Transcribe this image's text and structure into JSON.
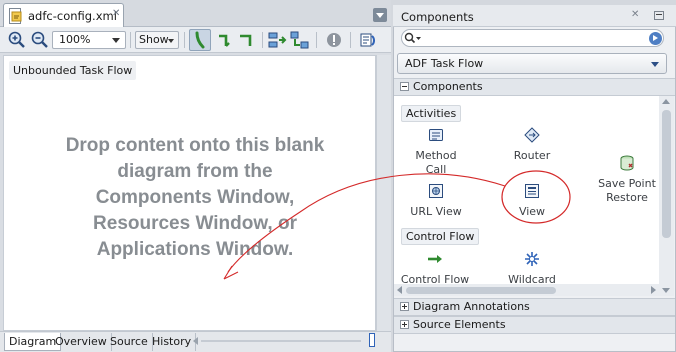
{
  "editor": {
    "tab_title": "adfc-config.xml",
    "zoom": "100%",
    "show_label": "Show",
    "canvas_label": "Unbounded Task Flow",
    "drop_lines": [
      "Drop content onto this blank",
      "diagram from the",
      "Components Window,",
      "Resources Window, or",
      "Applications Window."
    ],
    "bottom_tabs": [
      "Diagram",
      "Overview",
      "Source",
      "History"
    ]
  },
  "panel": {
    "title": "Components",
    "search_placeholder": "",
    "palette": "ADF Task Flow",
    "sections": {
      "components": "Components",
      "diagram_annotations": "Diagram Annotations",
      "source_elements": "Source Elements"
    },
    "activities_label": "Activities",
    "control_flow_label": "Control Flow",
    "items": [
      {
        "label": "Method Call",
        "icon": "method-call-icon"
      },
      {
        "label": "Router",
        "icon": "router-icon"
      },
      {
        "label": "Save Point\nRestore",
        "icon": "save-point-restore-icon"
      },
      {
        "label": "URL View",
        "icon": "url-view-icon"
      },
      {
        "label": "View",
        "icon": "view-icon"
      },
      {
        "label": "Control Flow",
        "icon": "control-flow-icon"
      },
      {
        "label": "Wildcard",
        "icon": "wildcard-icon"
      }
    ]
  },
  "colors": {
    "annotation_red": "#d42a2a",
    "accent_blue": "#2f63b8",
    "drop_text_gray": "#888d92"
  }
}
